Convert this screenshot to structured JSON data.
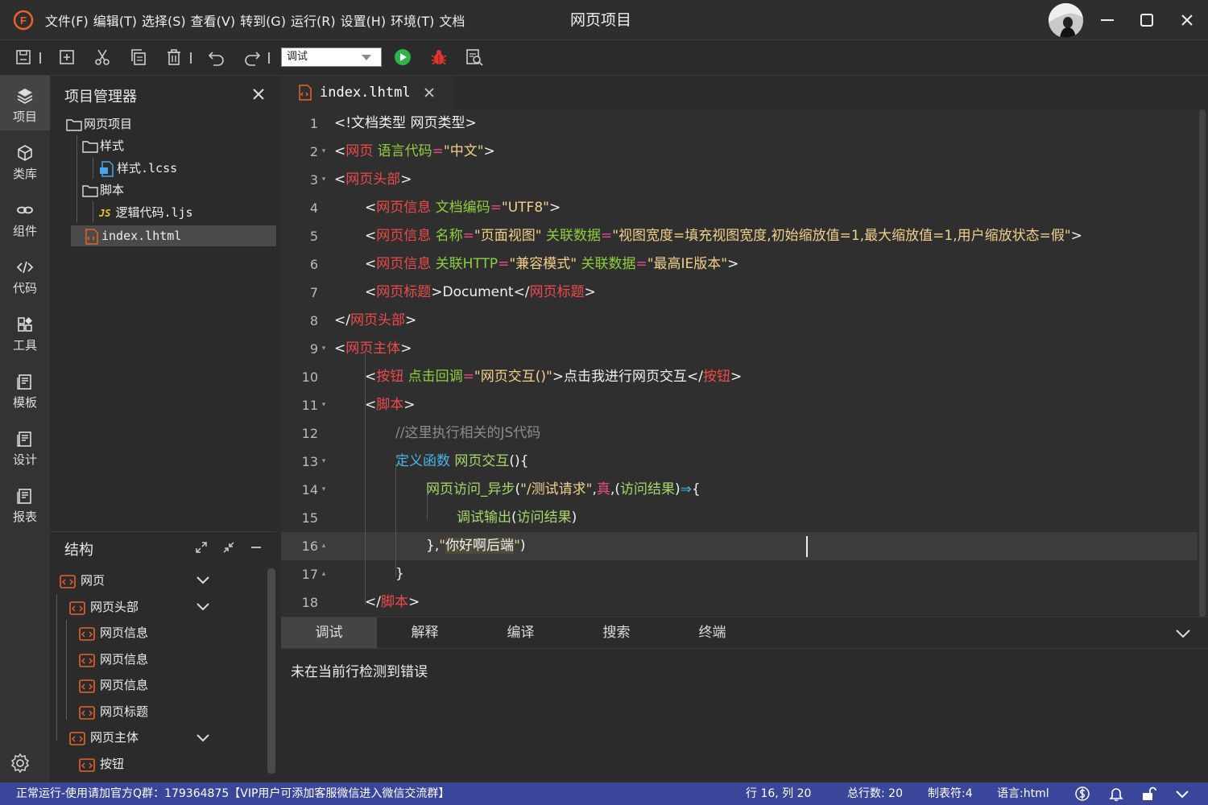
{
  "titlebar": {
    "menus": [
      "文件(F)",
      "编辑(T)",
      "选择(S)",
      "查看(V)",
      "转到(G)",
      "运行(R)",
      "设置(H)",
      "环境(T)",
      "文档"
    ],
    "window_title": "网页项目"
  },
  "toolbar": {
    "run_config_value": "调试"
  },
  "activitybar": {
    "items": [
      {
        "label": "项目",
        "icon": "layers-icon"
      },
      {
        "label": "类库",
        "icon": "cube-icon"
      },
      {
        "label": "组件",
        "icon": "link-icon"
      },
      {
        "label": "代码",
        "icon": "code-icon"
      },
      {
        "label": "工具",
        "icon": "grid-icon"
      },
      {
        "label": "模板",
        "icon": "template-icon"
      },
      {
        "label": "设计",
        "icon": "design-icon"
      },
      {
        "label": "报表",
        "icon": "report-icon"
      }
    ]
  },
  "explorer": {
    "title": "项目管理器",
    "tree": [
      "网页项目",
      "样式",
      "样式.lcss",
      "脚本",
      "逻辑代码.ljs",
      "index.lhtml"
    ]
  },
  "structure": {
    "title": "结构",
    "nodes": [
      "网页",
      "网页头部",
      "网页信息",
      "网页信息",
      "网页信息",
      "网页标题",
      "网页主体",
      "按钮"
    ]
  },
  "editor": {
    "tab_label": "index.lhtml",
    "current_line": 16,
    "lines": [
      {
        "n": "1",
        "fold": "",
        "tokens": [
          [
            "plain",
            "<!文档类型 网页类型>"
          ]
        ]
      },
      {
        "n": "2",
        "fold": "▾",
        "tokens": [
          [
            "plain",
            "<"
          ],
          [
            "tag",
            "网页"
          ],
          [
            "plain",
            " "
          ],
          [
            "attr",
            "语言代码"
          ],
          [
            "op",
            "="
          ],
          [
            "str",
            "\"中文\""
          ],
          [
            "plain",
            ">"
          ]
        ]
      },
      {
        "n": "3",
        "fold": "▾",
        "tokens": [
          [
            "plain",
            "<"
          ],
          [
            "tag",
            "网页头部"
          ],
          [
            "plain",
            ">"
          ]
        ]
      },
      {
        "n": "4",
        "fold": "",
        "tokens": [
          [
            "plain",
            "<"
          ],
          [
            "tag",
            "网页信息"
          ],
          [
            "plain",
            " "
          ],
          [
            "attr",
            "文档编码"
          ],
          [
            "op",
            "="
          ],
          [
            "str",
            "\"UTF8\""
          ],
          [
            "plain",
            ">"
          ]
        ]
      },
      {
        "n": "5",
        "fold": "",
        "tokens": [
          [
            "plain",
            "<"
          ],
          [
            "tag",
            "网页信息"
          ],
          [
            "plain",
            " "
          ],
          [
            "attr",
            "名称"
          ],
          [
            "op",
            "="
          ],
          [
            "str",
            "\"页面视图\""
          ],
          [
            "plain",
            " "
          ],
          [
            "attr",
            "关联数据"
          ],
          [
            "op",
            "="
          ],
          [
            "str",
            "\"视图宽度=填充视图宽度,初始缩放值=1,最大缩放值=1,用户缩放状态=假\""
          ],
          [
            "plain",
            ">"
          ]
        ]
      },
      {
        "n": "6",
        "fold": "",
        "tokens": [
          [
            "plain",
            "<"
          ],
          [
            "tag",
            "网页信息"
          ],
          [
            "plain",
            " "
          ],
          [
            "attr",
            "关联HTTP"
          ],
          [
            "op",
            "="
          ],
          [
            "str",
            "\"兼容模式\""
          ],
          [
            "plain",
            " "
          ],
          [
            "attr",
            "关联数据"
          ],
          [
            "op",
            "="
          ],
          [
            "str",
            "\"最高IE版本\""
          ],
          [
            "plain",
            ">"
          ]
        ]
      },
      {
        "n": "7",
        "fold": "",
        "tokens": [
          [
            "plain",
            "<"
          ],
          [
            "tag",
            "网页标题"
          ],
          [
            "plain",
            ">Document</"
          ],
          [
            "tag",
            "网页标题"
          ],
          [
            "plain",
            ">"
          ]
        ]
      },
      {
        "n": "8",
        "fold": "",
        "tokens": [
          [
            "plain",
            "</"
          ],
          [
            "tag",
            "网页头部"
          ],
          [
            "plain",
            ">"
          ]
        ]
      },
      {
        "n": "9",
        "fold": "▾",
        "tokens": [
          [
            "plain",
            "<"
          ],
          [
            "tag",
            "网页主体"
          ],
          [
            "plain",
            ">"
          ]
        ]
      },
      {
        "n": "10",
        "fold": "",
        "tokens": [
          [
            "plain",
            "<"
          ],
          [
            "tag",
            "按钮"
          ],
          [
            "plain",
            " "
          ],
          [
            "attr",
            "点击回调"
          ],
          [
            "op",
            "="
          ],
          [
            "str",
            "\"网页交互()\""
          ],
          [
            "plain",
            ">点击我进行网页交互</"
          ],
          [
            "tag",
            "按钮"
          ],
          [
            "plain",
            ">"
          ]
        ]
      },
      {
        "n": "11",
        "fold": "▾",
        "tokens": [
          [
            "plain",
            "<"
          ],
          [
            "tag",
            "脚本"
          ],
          [
            "plain",
            ">"
          ]
        ]
      },
      {
        "n": "12",
        "fold": "",
        "tokens": [
          [
            "com",
            "//这里执行相关的JS代码"
          ]
        ]
      },
      {
        "n": "13",
        "fold": "▾",
        "tokens": [
          [
            "kw",
            "定义函数"
          ],
          [
            "plain",
            " "
          ],
          [
            "fn",
            "网页交互"
          ],
          [
            "plain",
            "(){"
          ]
        ]
      },
      {
        "n": "14",
        "fold": "▾",
        "tokens": [
          [
            "fn",
            "网页访问_异步"
          ],
          [
            "plain",
            "("
          ],
          [
            "str",
            "\"/测试请求\""
          ],
          [
            "plain",
            ","
          ],
          [
            "bool",
            "真"
          ],
          [
            "plain",
            ",("
          ],
          [
            "fn",
            "访问结果"
          ],
          [
            "plain",
            ")"
          ],
          [
            "arrow",
            "⇒"
          ],
          [
            "plain",
            "{"
          ]
        ]
      },
      {
        "n": "15",
        "fold": "",
        "tokens": [
          [
            "fn",
            "调试输出"
          ],
          [
            "plain",
            "("
          ],
          [
            "fn",
            "访问结果"
          ],
          [
            "plain",
            ")"
          ]
        ]
      },
      {
        "n": "16",
        "fold": "▴",
        "tokens": [
          [
            "plain",
            "},"
          ],
          [
            "str",
            "\""
          ],
          [
            "sel",
            "你好啊后端"
          ],
          [
            "str",
            "\""
          ],
          [
            "plain",
            ")"
          ]
        ]
      },
      {
        "n": "17",
        "fold": "▴",
        "tokens": [
          [
            "plain",
            "}"
          ]
        ]
      },
      {
        "n": "18",
        "fold": "",
        "tokens": [
          [
            "plain",
            "</"
          ],
          [
            "tag",
            "脚本"
          ],
          [
            "plain",
            ">"
          ]
        ]
      }
    ]
  },
  "panel": {
    "tabs": [
      "调试",
      "解释",
      "编译",
      "搜索",
      "终端"
    ],
    "active_tab": "调试",
    "output": "未在当前行检测到错误"
  },
  "statusbar": {
    "message": "正常运行-使用请加官方Q群：179364875【VIP用户可添加客服微信进入微信交流群】",
    "position": "行 16, 列 20",
    "total_lines": "总行数: 20",
    "tab_size": "制表符:4",
    "language": "语言:html"
  },
  "colors": {
    "accent_status": "#3a4699",
    "tag": "#ee4a4a",
    "attr": "#8fcf3e",
    "string": "#f2d08a",
    "keyword": "#4ab6e8",
    "brand_orange": "#e8622c"
  }
}
